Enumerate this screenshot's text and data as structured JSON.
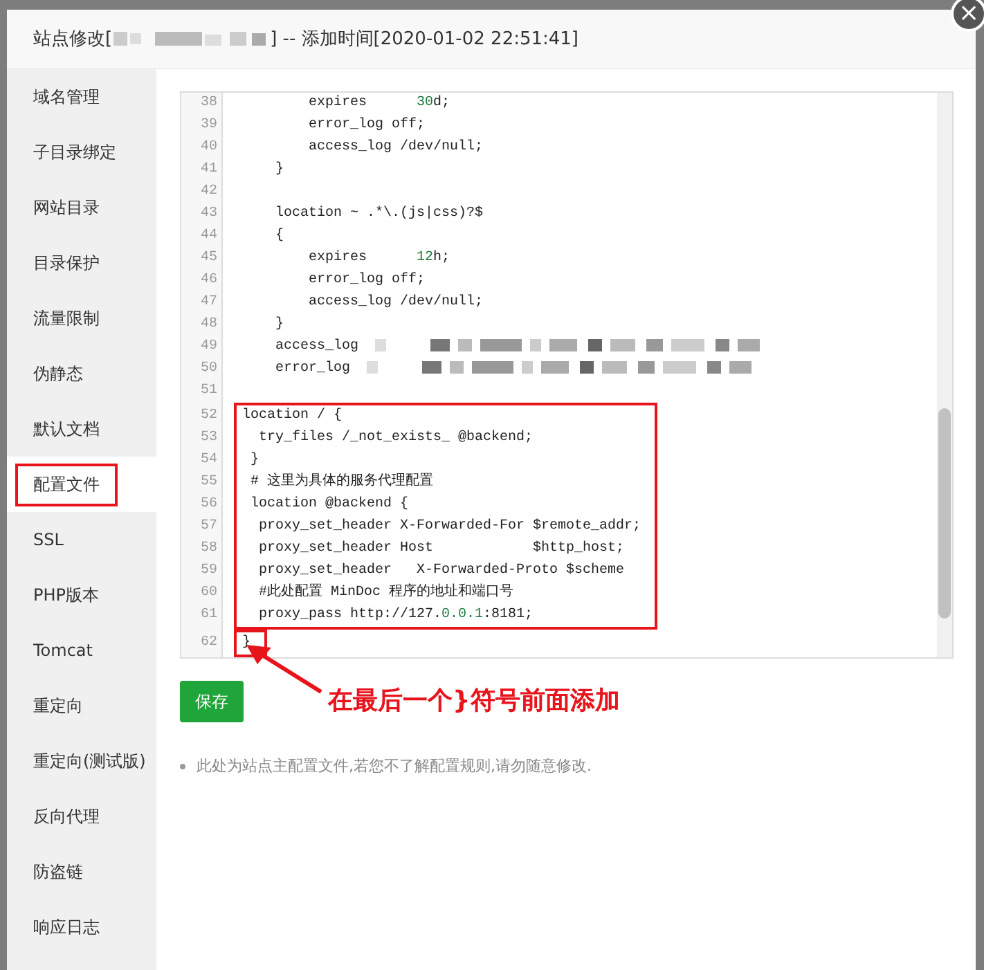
{
  "dialog": {
    "title_prefix": "站点修改[",
    "title_suffix": "] -- 添加时间[2020-01-02 22:51:41]",
    "close": "×"
  },
  "sidebar": {
    "items": [
      {
        "label": "域名管理",
        "selected": false
      },
      {
        "label": "子目录绑定",
        "selected": false
      },
      {
        "label": "网站目录",
        "selected": false
      },
      {
        "label": "目录保护",
        "selected": false
      },
      {
        "label": "流量限制",
        "selected": false
      },
      {
        "label": "伪静态",
        "selected": false
      },
      {
        "label": "默认文档",
        "selected": false
      },
      {
        "label": "配置文件",
        "selected": true
      },
      {
        "label": "SSL",
        "selected": false
      },
      {
        "label": "PHP版本",
        "selected": false
      },
      {
        "label": "Tomcat",
        "selected": false
      },
      {
        "label": "重定向",
        "selected": false
      },
      {
        "label": "重定向(测试版)",
        "selected": false
      },
      {
        "label": "反向代理",
        "selected": false
      },
      {
        "label": "防盗链",
        "selected": false
      },
      {
        "label": "响应日志",
        "selected": false
      }
    ]
  },
  "editor": {
    "blocks": [
      {
        "framed": false,
        "lines": [
          {
            "number": "38",
            "segments": [
              {
                "text": "        expires      ",
                "kind": "plain"
              },
              {
                "text": "30",
                "kind": "num"
              },
              {
                "text": "d;",
                "kind": "plain"
              }
            ]
          },
          {
            "number": "39",
            "segments": [
              {
                "text": "        error_log off;",
                "kind": "plain"
              }
            ]
          },
          {
            "number": "40",
            "segments": [
              {
                "text": "        access_log /dev/null;",
                "kind": "plain"
              }
            ]
          },
          {
            "number": "41",
            "segments": [
              {
                "text": "    }",
                "kind": "plain"
              }
            ]
          },
          {
            "number": "42"
          },
          {
            "number": "43",
            "segments": [
              {
                "text": "    location ~ .*\\.(js|css)?$",
                "kind": "plain"
              }
            ]
          },
          {
            "number": "44",
            "segments": [
              {
                "text": "    {",
                "kind": "plain"
              }
            ]
          },
          {
            "number": "45",
            "segments": [
              {
                "text": "        expires      ",
                "kind": "plain"
              },
              {
                "text": "12",
                "kind": "num"
              },
              {
                "text": "h;",
                "kind": "plain"
              }
            ]
          },
          {
            "number": "46",
            "segments": [
              {
                "text": "        error_log off;",
                "kind": "plain"
              }
            ]
          },
          {
            "number": "47",
            "segments": [
              {
                "text": "        access_log /dev/null;",
                "kind": "plain"
              }
            ]
          },
          {
            "number": "48",
            "segments": [
              {
                "text": "    }",
                "kind": "plain"
              }
            ]
          },
          {
            "number": "49",
            "segments": [
              {
                "text": "    access_log  ",
                "kind": "plain"
              },
              {
                "kind": "redacted"
              }
            ]
          },
          {
            "number": "50",
            "segments": [
              {
                "text": "    error_log  ",
                "kind": "plain"
              },
              {
                "kind": "redacted"
              }
            ]
          },
          {
            "number": "51"
          }
        ]
      },
      {
        "framed": true,
        "lines": [
          {
            "number": "52",
            "segments": [
              {
                "text": "location / {",
                "kind": "plain"
              }
            ]
          },
          {
            "number": "53",
            "segments": [
              {
                "text": "  try_files /_not_exists_ @backend;",
                "kind": "plain"
              }
            ]
          },
          {
            "number": "54",
            "segments": [
              {
                "text": " }",
                "kind": "plain"
              }
            ]
          },
          {
            "number": "55",
            "segments": [
              {
                "text": " # 这里为具体的服务代理配置",
                "kind": "plain"
              }
            ]
          },
          {
            "number": "56",
            "segments": [
              {
                "text": " location @backend {",
                "kind": "plain"
              }
            ]
          },
          {
            "number": "57",
            "segments": [
              {
                "text": "  proxy_set_header X-Forwarded-For $remote_addr;",
                "kind": "plain"
              }
            ]
          },
          {
            "number": "58",
            "segments": [
              {
                "text": "  proxy_set_header Host            $http_host;",
                "kind": "plain"
              }
            ]
          },
          {
            "number": "59",
            "segments": [
              {
                "text": "  proxy_set_header   X-Forwarded-Proto $scheme",
                "kind": "plain"
              }
            ]
          },
          {
            "number": "60",
            "segments": [
              {
                "text": "  #此处配置 MinDoc 程序的地址和端口号",
                "kind": "plain"
              }
            ]
          },
          {
            "number": "61",
            "segments": [
              {
                "text": "  proxy_pass http://127.",
                "kind": "plain"
              },
              {
                "text": "0.0.1",
                "kind": "num"
              },
              {
                "text": ":8181;",
                "kind": "plain"
              }
            ]
          }
        ]
      },
      {
        "framed": true,
        "lines": [
          {
            "number": "62",
            "segments": [
              {
                "text": "}",
                "kind": "plain"
              }
            ]
          }
        ]
      }
    ]
  },
  "save_button": "保存",
  "annotation": "在最后一个}符号前面添加",
  "note": "此处为站点主配置文件,若您不了解配置规则,请勿随意修改."
}
